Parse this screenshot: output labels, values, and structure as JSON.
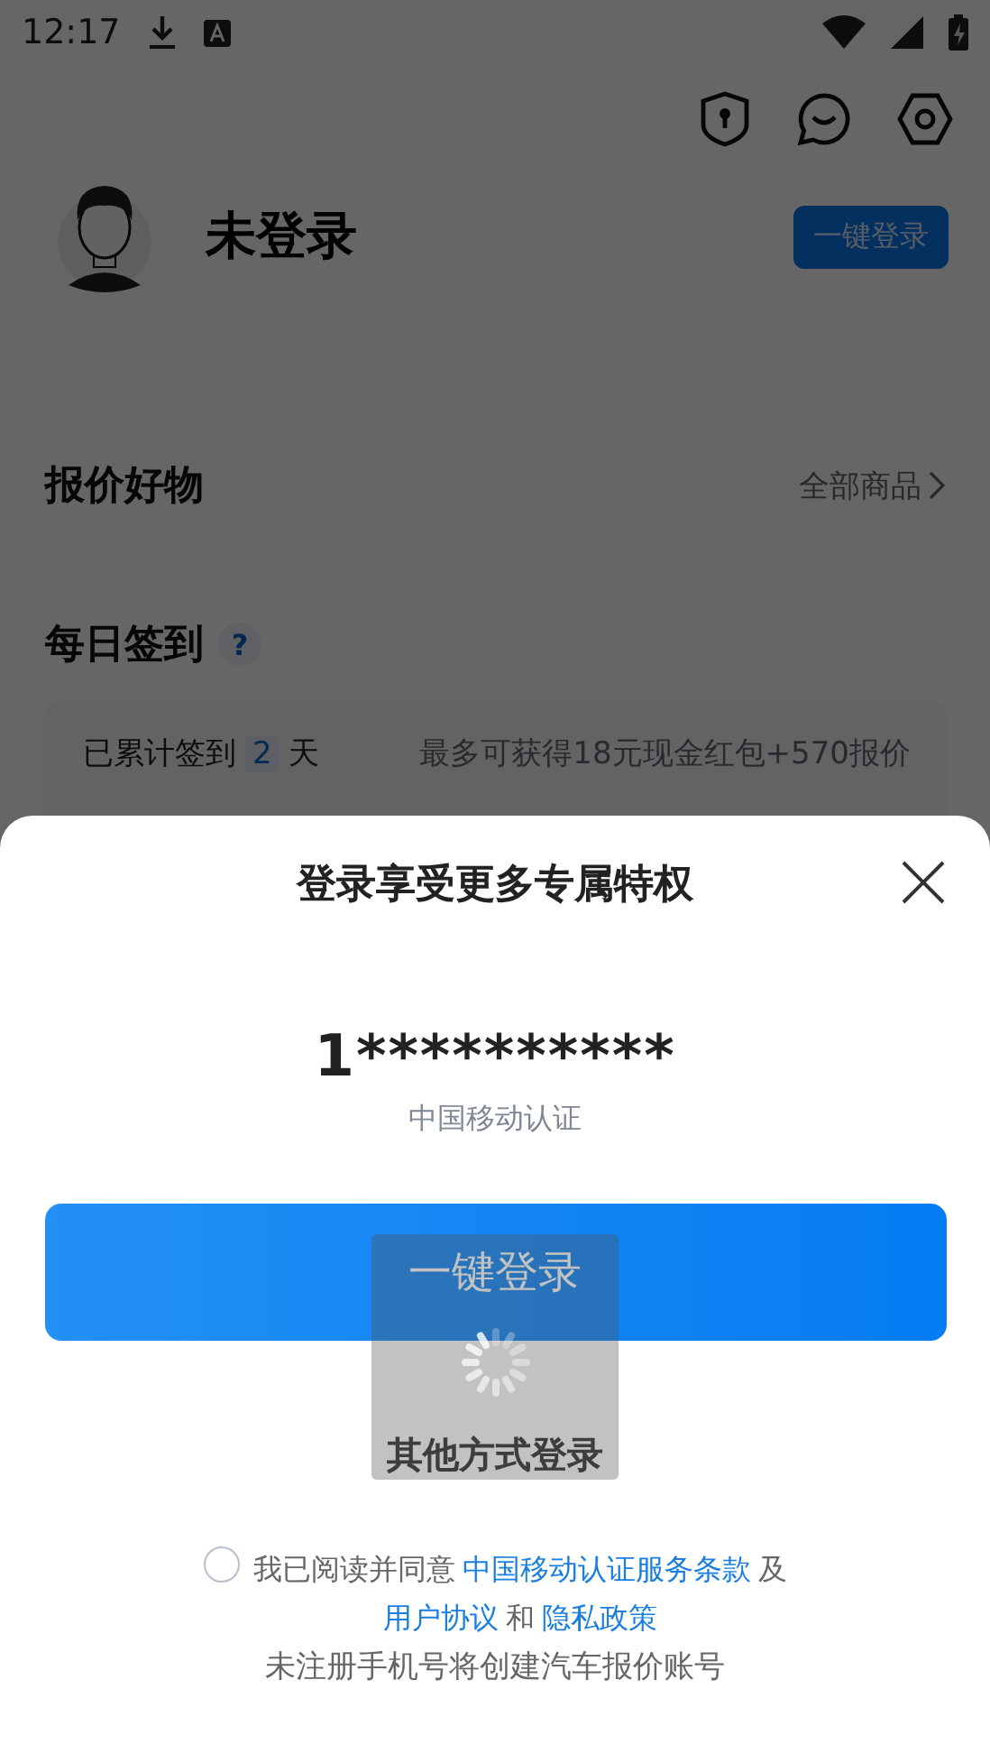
{
  "status_bar": {
    "time": "12:17"
  },
  "profile": {
    "name": "未登录",
    "login_button": "一键登录"
  },
  "goods_section": {
    "title": "报价好物",
    "link": "全部商品"
  },
  "checkin": {
    "title": "每日签到",
    "help": "?",
    "streak_prefix": "已累计签到",
    "streak_days": "2",
    "streak_suffix": "天",
    "reward": "最多可获得18元现金红包+570报价"
  },
  "login_sheet": {
    "title": "登录享受更多专属特权",
    "phone": "1**********",
    "carrier": "中国移动认证",
    "primary_button": "一键登录",
    "other_login": "其他方式登录",
    "agreement": {
      "checked": false,
      "parts": [
        {
          "kind": "text",
          "text": "我已阅读并同意"
        },
        {
          "kind": "link",
          "text": "中国移动认证服务条款"
        },
        {
          "kind": "text",
          "text": "及"
        },
        {
          "kind": "break"
        },
        {
          "kind": "link",
          "text": "用户协议"
        },
        {
          "kind": "text",
          "text": "和"
        },
        {
          "kind": "link",
          "text": "隐私政策"
        }
      ]
    },
    "note": "未注册手机号将创建汽车报价账号"
  },
  "loading": true
}
